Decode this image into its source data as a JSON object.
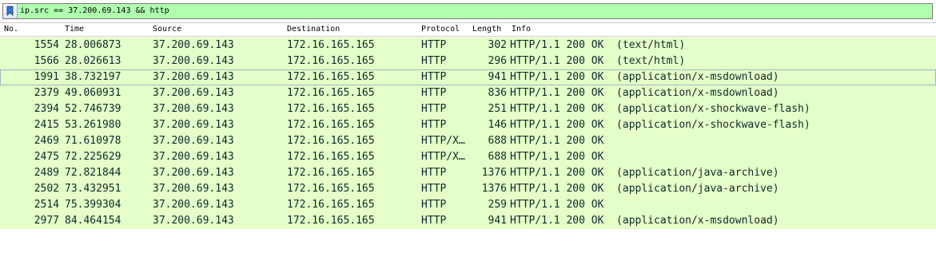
{
  "filter": {
    "value": "ip.src == 37.200.69.143 && http",
    "bookmark_icon": "bookmark-icon",
    "background_color": "#afffaf"
  },
  "columns": [
    "No.",
    "Time",
    "Source",
    "Destination",
    "Protocol",
    "Length",
    "Info"
  ],
  "row_color": "#e4ffc7",
  "rows": [
    {
      "no": "1554",
      "time": "28.006873",
      "source": "37.200.69.143",
      "destination": "172.16.165.165",
      "protocol": "HTTP",
      "length": "302",
      "info": "HTTP/1.1 200 OK  (text/html)"
    },
    {
      "no": "1566",
      "time": "28.026613",
      "source": "37.200.69.143",
      "destination": "172.16.165.165",
      "protocol": "HTTP",
      "length": "296",
      "info": "HTTP/1.1 200 OK  (text/html)"
    },
    {
      "no": "1991",
      "time": "38.732197",
      "source": "37.200.69.143",
      "destination": "172.16.165.165",
      "protocol": "HTTP",
      "length": "941",
      "info": "HTTP/1.1 200 OK  (application/x-msdownload)",
      "selected": true
    },
    {
      "no": "2379",
      "time": "49.060931",
      "source": "37.200.69.143",
      "destination": "172.16.165.165",
      "protocol": "HTTP",
      "length": "836",
      "info": "HTTP/1.1 200 OK  (application/x-msdownload)"
    },
    {
      "no": "2394",
      "time": "52.746739",
      "source": "37.200.69.143",
      "destination": "172.16.165.165",
      "protocol": "HTTP",
      "length": "251",
      "info": "HTTP/1.1 200 OK  (application/x-shockwave-flash)"
    },
    {
      "no": "2415",
      "time": "53.261980",
      "source": "37.200.69.143",
      "destination": "172.16.165.165",
      "protocol": "HTTP",
      "length": "146",
      "info": "HTTP/1.1 200 OK  (application/x-shockwave-flash)"
    },
    {
      "no": "2469",
      "time": "71.610978",
      "source": "37.200.69.143",
      "destination": "172.16.165.165",
      "protocol": "HTTP/X…",
      "length": "688",
      "info": "HTTP/1.1 200 OK"
    },
    {
      "no": "2475",
      "time": "72.225629",
      "source": "37.200.69.143",
      "destination": "172.16.165.165",
      "protocol": "HTTP/X…",
      "length": "688",
      "info": "HTTP/1.1 200 OK"
    },
    {
      "no": "2489",
      "time": "72.821844",
      "source": "37.200.69.143",
      "destination": "172.16.165.165",
      "protocol": "HTTP",
      "length": "1376",
      "info": "HTTP/1.1 200 OK  (application/java-archive)"
    },
    {
      "no": "2502",
      "time": "73.432951",
      "source": "37.200.69.143",
      "destination": "172.16.165.165",
      "protocol": "HTTP",
      "length": "1376",
      "info": "HTTP/1.1 200 OK  (application/java-archive)"
    },
    {
      "no": "2514",
      "time": "75.399304",
      "source": "37.200.69.143",
      "destination": "172.16.165.165",
      "protocol": "HTTP",
      "length": "259",
      "info": "HTTP/1.1 200 OK"
    },
    {
      "no": "2977",
      "time": "84.464154",
      "source": "37.200.69.143",
      "destination": "172.16.165.165",
      "protocol": "HTTP",
      "length": "941",
      "info": "HTTP/1.1 200 OK  (application/x-msdownload)"
    }
  ]
}
